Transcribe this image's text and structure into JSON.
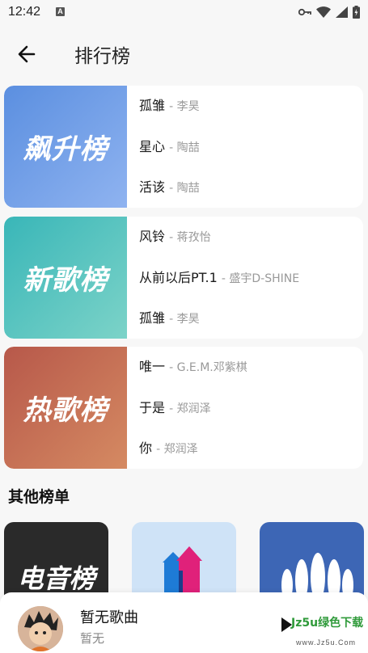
{
  "status": {
    "time": "12:42",
    "a_icon": "A"
  },
  "header": {
    "title": "排行榜"
  },
  "charts": [
    {
      "cover_label": "飙升榜",
      "gradient": [
        "#5b8fe0",
        "#8fb3f0"
      ],
      "songs": [
        {
          "title": "孤雏",
          "artist": "- 李昊"
        },
        {
          "title": "星心",
          "artist": "- 陶喆"
        },
        {
          "title": "活该",
          "artist": "- 陶喆"
        }
      ]
    },
    {
      "cover_label": "新歌榜",
      "gradient": [
        "#39b6b8",
        "#7cd3c8"
      ],
      "songs": [
        {
          "title": "风铃",
          "artist": "- 蒋孜怡"
        },
        {
          "title": "从前以后PT.1",
          "artist": "- 盛宇D-SHINE"
        },
        {
          "title": "孤雏",
          "artist": "- 李昊"
        }
      ]
    },
    {
      "cover_label": "热歌榜",
      "gradient": [
        "#b7584a",
        "#d58a62"
      ],
      "songs": [
        {
          "title": "唯一",
          "artist": "- G.E.M.邓紫棋"
        },
        {
          "title": "于是",
          "artist": "- 郑润泽"
        },
        {
          "title": "你",
          "artist": "- 郑润泽"
        }
      ]
    }
  ],
  "other": {
    "section_title": "其他榜单",
    "tiles": [
      {
        "label": "电音榜",
        "bg": "#2a2a2a",
        "icon": "text"
      },
      {
        "label": "",
        "bg": "#cfe3f7",
        "icon": "up-arrows-icon"
      },
      {
        "label": "",
        "bg": "#3d66b5",
        "icon": "crowd-icon"
      }
    ]
  },
  "player": {
    "title": "暂无歌曲",
    "subtitle": "暂无"
  },
  "watermark": {
    "line1": "Jz5u绿色下载",
    "line2": "www.Jz5u.Com"
  }
}
